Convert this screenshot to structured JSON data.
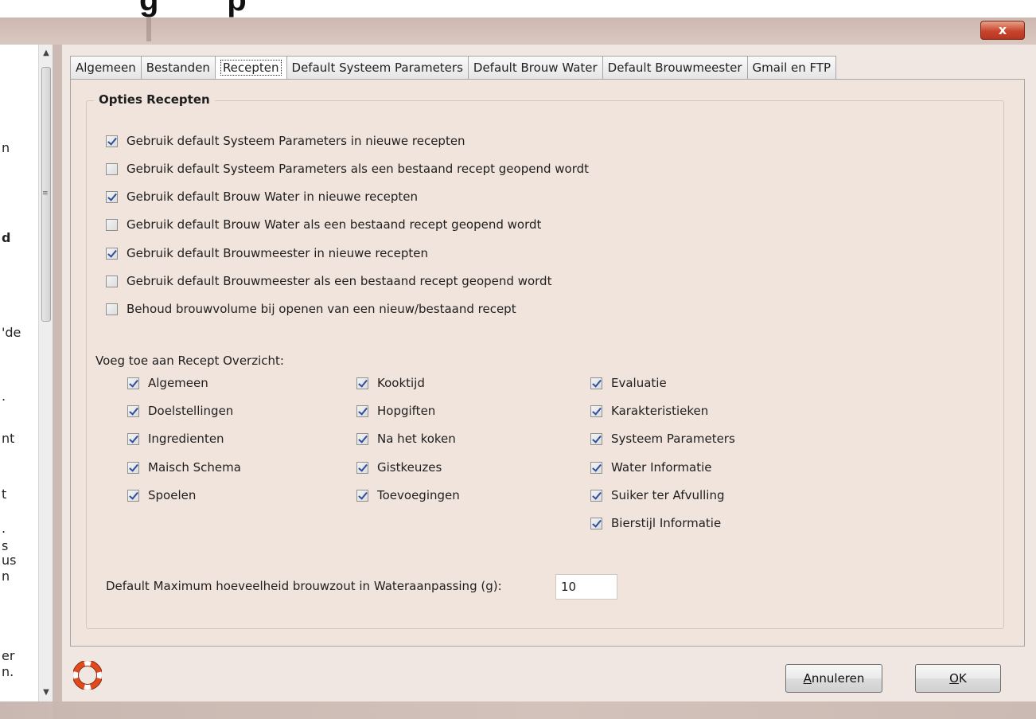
{
  "window": {
    "close_label": "x"
  },
  "left_fragments": [
    "n",
    "d",
    "'de",
    ".",
    "nt",
    "t",
    ".",
    "s",
    "us",
    "n",
    "er",
    "n."
  ],
  "tabs": [
    {
      "label": "Algemeen",
      "active": false
    },
    {
      "label": "Bestanden",
      "active": false
    },
    {
      "label": "Recepten",
      "active": true
    },
    {
      "label": "Default Systeem Parameters",
      "active": false
    },
    {
      "label": "Default Brouw Water",
      "active": false
    },
    {
      "label": "Default Brouwmeester",
      "active": false
    },
    {
      "label": "Gmail en FTP",
      "active": false
    }
  ],
  "options": {
    "group_title": "Opties Recepten",
    "items": [
      {
        "label": "Gebruik default Systeem Parameters in nieuwe recepten",
        "checked": true
      },
      {
        "label": "Gebruik default Systeem Parameters als een bestaand recept geopend wordt",
        "checked": false
      },
      {
        "label": "Gebruik default Brouw Water in nieuwe recepten",
        "checked": true
      },
      {
        "label": "Gebruik default Brouw Water als een bestaand recept geopend wordt",
        "checked": false
      },
      {
        "label": "Gebruik default Brouwmeester in nieuwe recepten",
        "checked": true
      },
      {
        "label": "Gebruik default Brouwmeester als een bestaand recept geopend wordt",
        "checked": false
      },
      {
        "label": "Behoud brouwvolume bij openen van een nieuw/bestaand recept",
        "checked": false
      }
    ]
  },
  "overview": {
    "label": "Voeg toe aan Recept Overzicht:",
    "columns": [
      [
        {
          "label": "Algemeen",
          "checked": true
        },
        {
          "label": "Doelstellingen",
          "checked": true
        },
        {
          "label": "Ingredienten",
          "checked": true
        },
        {
          "label": "Maisch Schema",
          "checked": true
        },
        {
          "label": "Spoelen",
          "checked": true
        }
      ],
      [
        {
          "label": "Kooktijd",
          "checked": true
        },
        {
          "label": "Hopgiften",
          "checked": true
        },
        {
          "label": "Na het koken",
          "checked": true
        },
        {
          "label": "Gistkeuzes",
          "checked": true
        },
        {
          "label": "Toevoegingen",
          "checked": true
        }
      ],
      [
        {
          "label": "Evaluatie",
          "checked": true
        },
        {
          "label": "Karakteristieken",
          "checked": true
        },
        {
          "label": "Systeem Parameters",
          "checked": true
        },
        {
          "label": "Water Informatie",
          "checked": true
        },
        {
          "label": "Suiker ter Afvulling",
          "checked": true
        },
        {
          "label": "Bierstijl Informatie",
          "checked": true
        }
      ]
    ]
  },
  "max_salt": {
    "label": "Default Maximum hoeveelheid brouwzout in Wateraanpassing (g):",
    "value": "10"
  },
  "footer": {
    "help_icon": "lifebuoy-icon",
    "cancel_rest": "nnuleren",
    "cancel_mnemonic": "A",
    "ok_rest": "K",
    "ok_mnemonic": "O"
  },
  "colors": {
    "dialog_bg": "#f1e4dc",
    "check_color": "#2e4f9f",
    "lifebuoy_red": "#e04a1c"
  }
}
